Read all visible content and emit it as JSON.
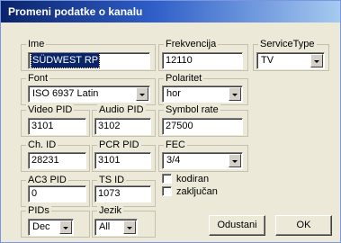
{
  "window": {
    "title": "Promeni podatke o kanalu"
  },
  "fields": {
    "ime": {
      "label": "Ime",
      "value": "SÜDWEST RP"
    },
    "frekvencija": {
      "label": "Frekvencija",
      "value": "12110"
    },
    "service_type": {
      "label": "ServiceType",
      "value": "TV"
    },
    "font": {
      "label": "Font",
      "value": "ISO 6937 Latin"
    },
    "polaritet": {
      "label": "Polaritet",
      "value": "hor"
    },
    "video_pid": {
      "label": "Video PID",
      "value": "3101"
    },
    "audio_pid": {
      "label": "Audio PID",
      "value": "3102"
    },
    "symbol_rate": {
      "label": "Symbol rate",
      "value": "27500"
    },
    "ch_id": {
      "label": "Ch. ID",
      "value": "28231"
    },
    "pcr_pid": {
      "label": "PCR PID",
      "value": "3101"
    },
    "fec": {
      "label": "FEC",
      "value": "3/4"
    },
    "ac3_pid": {
      "label": "AC3 PID",
      "value": "0"
    },
    "ts_id": {
      "label": "TS ID",
      "value": "1073"
    },
    "pids": {
      "label": "PIDs",
      "value": "Dec"
    },
    "jezik": {
      "label": "Jezik",
      "value": "All"
    }
  },
  "checkboxes": {
    "kodiran": {
      "label": "kodiran",
      "checked": false
    },
    "zakljucan": {
      "label": "zaključan",
      "checked": false
    }
  },
  "buttons": {
    "cancel": "Odustani",
    "ok": "OK"
  },
  "icons": {
    "dropdown": "chevron-down-icon"
  },
  "colors": {
    "titlebar_start": "#0a246a",
    "titlebar_end": "#a6caf0",
    "face": "#ece9d8",
    "selection": "#0a246a"
  }
}
